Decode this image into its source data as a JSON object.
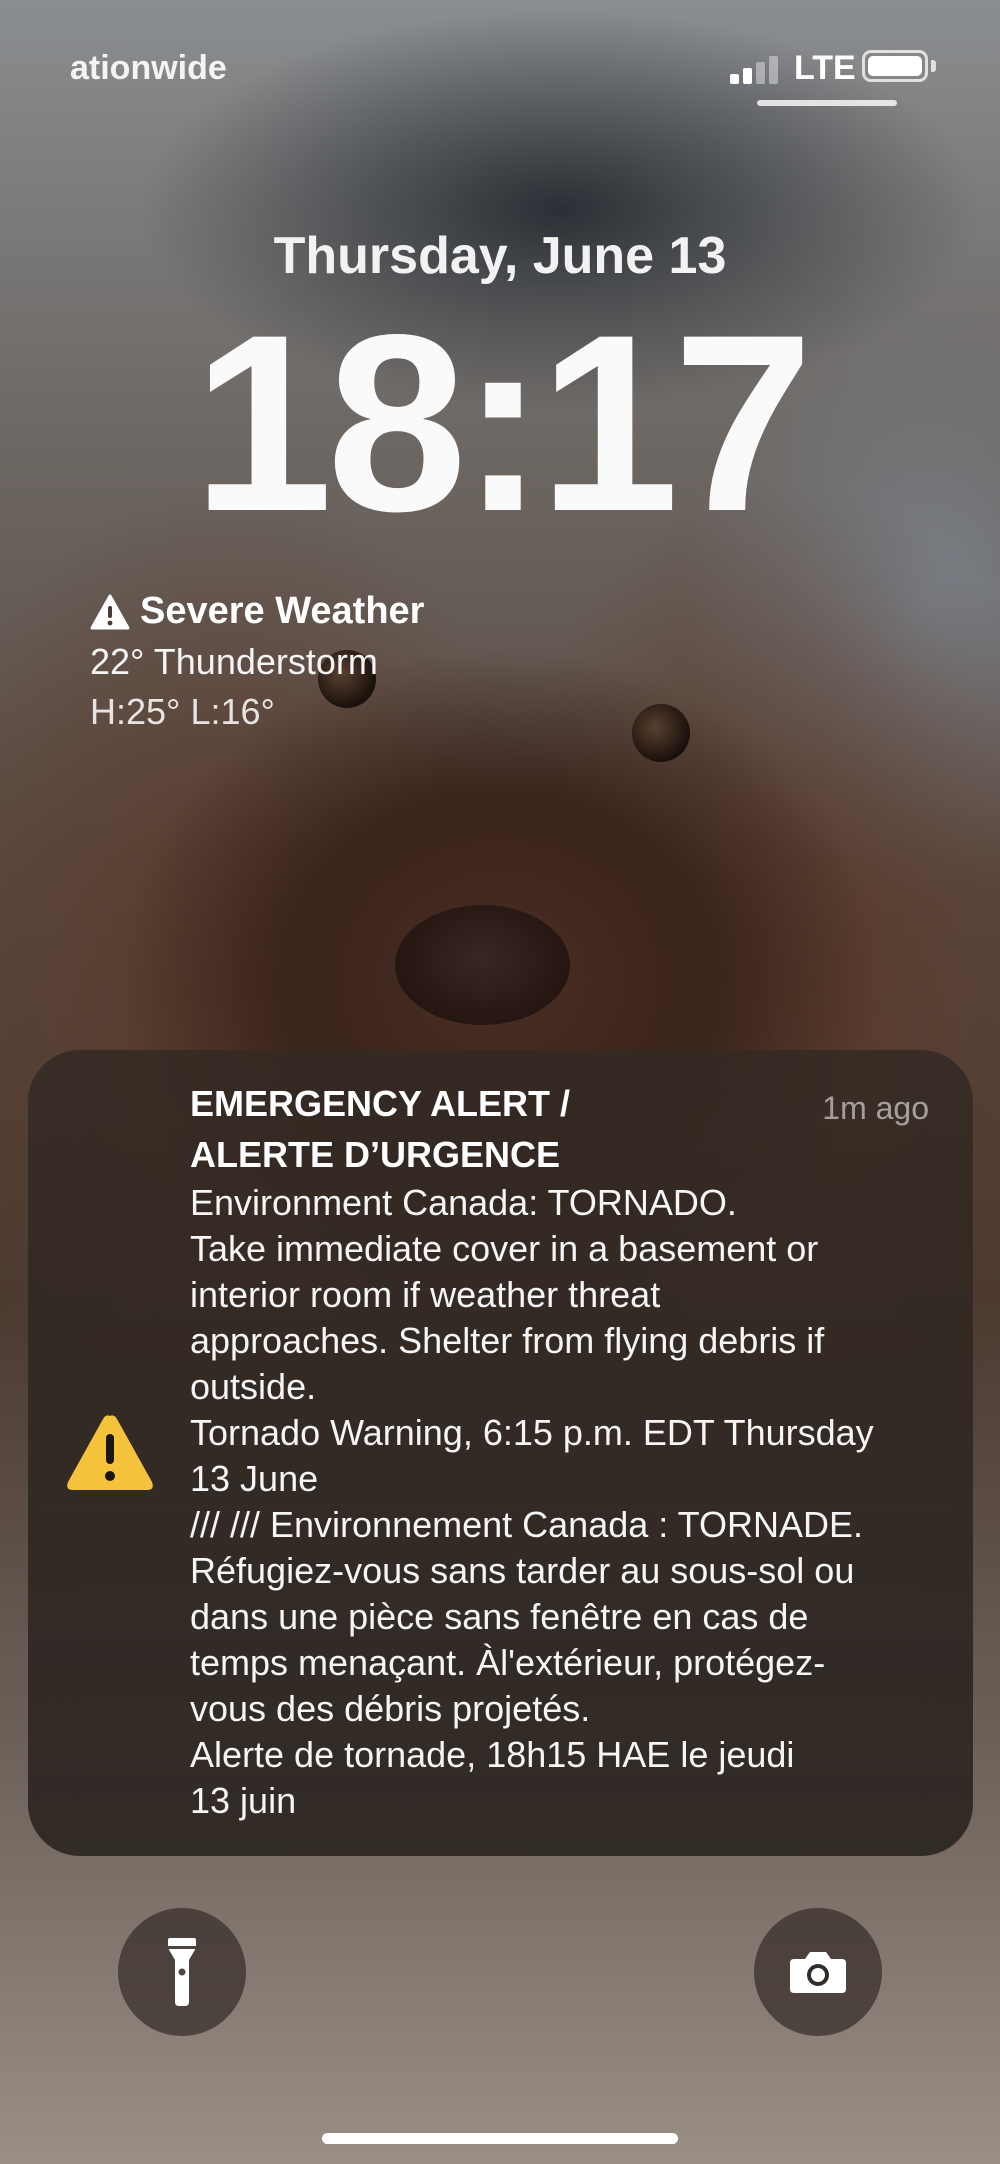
{
  "status_bar": {
    "carrier": "ationwide",
    "network": "LTE"
  },
  "lock_screen": {
    "date": "Thursday, June 13",
    "time": "18:17"
  },
  "weather": {
    "title": "Severe Weather",
    "current": "22° Thunderstorm",
    "high_low": "H:25° L:16°"
  },
  "notification": {
    "title": "EMERGENCY ALERT /\nALERTE D’URGENCE",
    "time_ago": "1m ago",
    "body": "Environment Canada: TORNADO.\nTake immediate cover in a basement or\ninterior room if weather threat\napproaches. Shelter from flying debris if\noutside.\nTornado Warning, 6:15 p.m. EDT Thursday\n13 June\n/// /// Environnement Canada : TORNADE.\nRéfugiez-vous sans tarder au sous-sol ou\ndans une pièce sans fenêtre en cas de\ntemps menaçant. Àl'extérieur, protégez-\nvous des débris projetés.\nAlerte de tornade, 18h15 HAE le jeudi\n13 juin",
    "icon_color": "#F5C33B"
  },
  "controls": {
    "left": "flashlight-icon",
    "right": "camera-icon"
  }
}
